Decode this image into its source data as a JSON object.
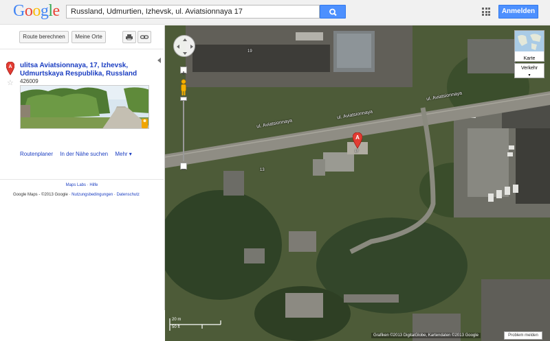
{
  "header": {
    "search_value": "Russland, Udmurtien, Izhevsk, ul. Aviatsionnaya 17",
    "signin_label": "Anmelden"
  },
  "toolbar": {
    "route_label": "Route berechnen",
    "myplaces_label": "Meine Orte"
  },
  "place": {
    "marker": "A",
    "address": "ulitsa Aviatsionnaya, 17, Izhevsk, Udmurtskaya Respublika, Russland",
    "zip": "426009"
  },
  "links": {
    "route_planner": "Routenplaner",
    "nearby": "In der Nähe suchen",
    "more": "Mehr"
  },
  "footer": {
    "labs": "Maps Labs",
    "help": "Hilfe",
    "copyright": "Google Maps - ©2013 Google",
    "terms": "Nutzungsbedingungen",
    "privacy": "Datenschutz"
  },
  "map": {
    "road_label": "ul. Aviatsionnaya",
    "house_label_1": "19",
    "house_label_2": "13",
    "marker": "A",
    "marker_sub": "17",
    "type_label": "Karte",
    "traffic_label": "Verkehr",
    "scale_m": "20 m",
    "scale_ft": "50 ft",
    "attribution": "Grafiken ©2013 DigitalGlobe, Kartendaten ©2013 Google",
    "report_label": "Problem melden"
  }
}
